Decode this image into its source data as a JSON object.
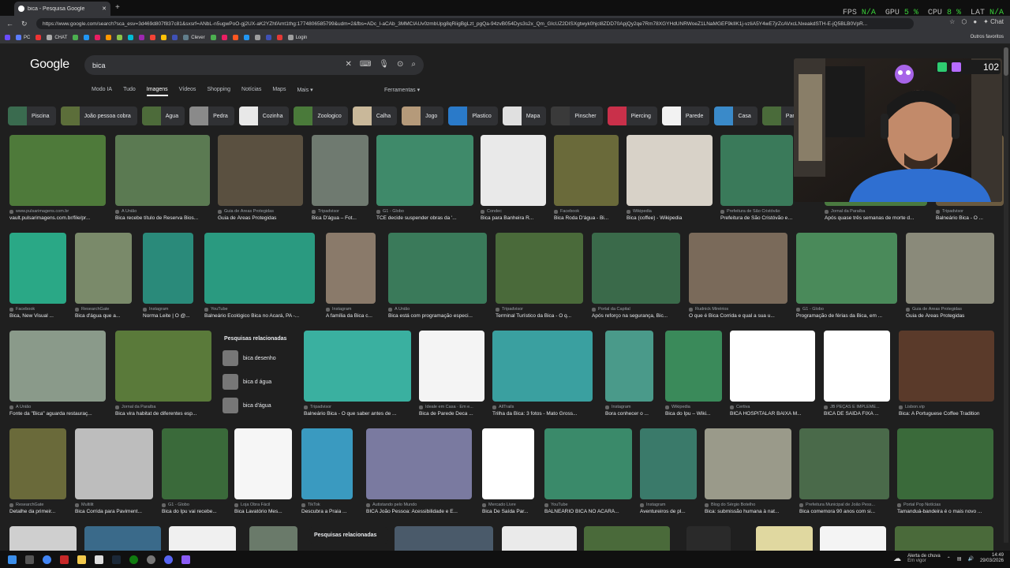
{
  "browser": {
    "tab_title": "bica - Pesquisa Google",
    "new_tab": "+",
    "url": "https://www.google.com/search?sca_esv=3d469d807f837c81&sxsrf=ANbL-n5ugwPoO-gj2UX-aK2YZhfAmt1thg:1774806585799&udm=2&fbs=ADc_l-aCAb_3MMCIAUv0zmbUpg8qRiigBgLzt_pgQa-94zvB054Dys3s2x_Qm_GIcUZ2DISXgtwyk0hjcl8ZDD70ApjQy2qe7Rm78XGYHdUNRWoeZ1LNaMGEF9kIlK1j-vzIiA5Y4wE7jrZcAVxcLNxeakdSTH-E-jQ5BLB0VpR...",
    "perf": {
      "fps_label": "FPS",
      "fps": "N/A",
      "gpu_label": "GPU",
      "gpu": "5 %",
      "cpu_label": "CPU",
      "cpu": "8 %",
      "lat_label": "LAT",
      "lat": "N/A"
    },
    "chat_label": "Chat",
    "bookmarks": [
      {
        "label": "",
        "color": "#6a4cff"
      },
      {
        "label": "PC",
        "color": "#5b7cff"
      },
      {
        "label": "",
        "color": "#e33"
      },
      {
        "label": "CHAT",
        "color": "#aaa"
      },
      {
        "label": "",
        "color": "#4caf50"
      },
      {
        "label": "",
        "color": "#2196f3"
      },
      {
        "label": "",
        "color": "#e91e63"
      },
      {
        "label": "",
        "color": "#ff9800"
      },
      {
        "label": "",
        "color": "#8bc34a"
      },
      {
        "label": "",
        "color": "#00bcd4"
      },
      {
        "label": "",
        "color": "#9c27b0"
      },
      {
        "label": "",
        "color": "#f44336"
      },
      {
        "label": "",
        "color": "#ffc107"
      },
      {
        "label": "",
        "color": "#3f51b5"
      },
      {
        "label": "Clever",
        "color": "#607d8b"
      },
      {
        "label": "",
        "color": "#4caf50"
      },
      {
        "label": "",
        "color": "#e91e63"
      },
      {
        "label": "",
        "color": "#ff5722"
      },
      {
        "label": "",
        "color": "#2196f3"
      },
      {
        "label": "",
        "color": "#9e9e9e"
      },
      {
        "label": "",
        "color": "#3f51b5"
      },
      {
        "label": "",
        "color": "#e53935"
      },
      {
        "label": "Login",
        "color": "#9e9e9e"
      }
    ],
    "other_bookmarks": "Outros favoritos"
  },
  "google": {
    "logo": "Google",
    "query": "bica",
    "modes": [
      "Modo IA",
      "Tudo",
      "Imagens",
      "Vídeos",
      "Shopping",
      "Notícias",
      "Maps",
      "Mais ▾"
    ],
    "active_mode": "Imagens",
    "tools": "Ferramentas ▾",
    "chips": [
      {
        "label": "Piscina",
        "color": "#3a6b4f"
      },
      {
        "label": "João pessoa cobra",
        "color": "#5c6e3a"
      },
      {
        "label": "Agua",
        "color": "#4d6b3a"
      },
      {
        "label": "Pedra",
        "color": "#8a8a8a"
      },
      {
        "label": "Cozinha",
        "color": "#e8e8e8"
      },
      {
        "label": "Zoologico",
        "color": "#4a7a3a"
      },
      {
        "label": "Calha",
        "color": "#c9b89a"
      },
      {
        "label": "Jogo",
        "color": "#b59a7a"
      },
      {
        "label": "Plastico",
        "color": "#2a7ac9"
      },
      {
        "label": "Mapa",
        "color": "#e0e0e0"
      },
      {
        "label": "Pinscher",
        "color": "#3a3a3a"
      },
      {
        "label": "Piercing",
        "color": "#c9304a"
      },
      {
        "label": "Parede",
        "color": "#f2f2f2"
      },
      {
        "label": "Casa",
        "color": "#3a8ac9"
      },
      {
        "label": "Parque",
        "color": "#4a6b3a"
      }
    ],
    "results": [
      {
        "src": "www.pulsarimagens.com.br",
        "cap": "vault.pulsarimagens.com.br/file/pr..."
      },
      {
        "src": "A União",
        "cap": "Bica recebe título de Reserva Bios..."
      },
      {
        "src": "Guia de Áreas Protegidas",
        "cap": "Guia de Áreas Protegidas"
      },
      {
        "src": "Tripadvisor",
        "cap": "Bica D'água – Fot..."
      },
      {
        "src": "G1 - Globo",
        "cap": "TCE decide suspender obras da '..."
      },
      {
        "src": "Condec",
        "cap": "Bica para Banheira R..."
      },
      {
        "src": "Facebook",
        "cap": "Bica Roda D'água - Bi..."
      },
      {
        "src": "Wikipedia",
        "cap": "Bica (coffee) - Wikipedia"
      },
      {
        "src": "Prefeitura de São Cristóvão",
        "cap": "Prefeitura de São Cristóvão entreg..."
      },
      {
        "src": "Jornal da Paraíba",
        "cap": "Após quase três semanas de morte d..."
      },
      {
        "src": "Tripadvisor",
        "cap": "Balneário Bica - O ..."
      },
      {
        "src": "Facebook",
        "cap": "Bica, New Visual ..."
      },
      {
        "src": "ResearchGate",
        "cap": "Bica d'água que a..."
      },
      {
        "src": "Instagram",
        "cap": "Norma Leite | O @..."
      },
      {
        "src": "YouTube",
        "cap": "Balneário Ecológico Bica no Acará, PA -..."
      },
      {
        "src": "Instagram",
        "cap": "A família da Bica c..."
      },
      {
        "src": "A União",
        "cap": "Bica está com programação especi..."
      },
      {
        "src": "Tripadvisor",
        "cap": "Terminal Turístico da Bica - O q..."
      },
      {
        "src": "Portal da Capital",
        "cap": "Após reforço na segurança, Bic..."
      },
      {
        "src": "Rudnick Minérios",
        "cap": "O que é Bica Corrida e qual a sua u..."
      },
      {
        "src": "G1 - Globo",
        "cap": "Programação de férias da Bica, em ..."
      },
      {
        "src": "Guia de Áreas Protegidas",
        "cap": "Guia de Áreas Protegidas"
      },
      {
        "src": "A União",
        "cap": "Fonte da \"Bica\" aguarda restauraç..."
      },
      {
        "src": "Jornal da Paraíba",
        "cap": "Bica vira habitat de diferentes esp..."
      },
      {
        "src": "Tripadvisor",
        "cap": "Balneário Bica - O que saber antes de ..."
      },
      {
        "src": "Ideale em Casa · Em e...",
        "cap": "Bica de Parede Deca ..."
      },
      {
        "src": "AllTrails",
        "cap": "Trilha da Bica: 3 fotos - Mato Gross..."
      },
      {
        "src": "Instagram",
        "cap": "Bora conhecer o ..."
      },
      {
        "src": "Wikipedia",
        "cap": "Bica do Ipu – Wiki..."
      },
      {
        "src": "Certiva",
        "cap": "BICA HOSPITALAR BAIXA M..."
      },
      {
        "src": "JB PEÇAS E IMPLEME...",
        "cap": "BICA DE SAÍDA FIXA ..."
      },
      {
        "src": "Lisbon.vip",
        "cap": "Bica: A Portuguese Coffee Tradition"
      },
      {
        "src": "ResearchGate",
        "cap": "Detalhe da primeir..."
      },
      {
        "src": "Multilit",
        "cap": "Bica Corrida para Paviment..."
      },
      {
        "src": "G1 - Globo",
        "cap": "Bica do Ipu vai recebe..."
      },
      {
        "src": "Loja Obra Fácil",
        "cap": "Bica Lavatório Mes..."
      },
      {
        "src": "TikTok",
        "cap": "Descubra a Praia ..."
      },
      {
        "src": "Autistando pelo Mundo",
        "cap": "BICA João Pessoa: Acessibilidade e E..."
      },
      {
        "src": "Mercado Livre",
        "cap": "Bica De Saída Par..."
      },
      {
        "src": "YouTube",
        "cap": "BALNEÁRIO BICA NO ACARÁ..."
      },
      {
        "src": "Instagram",
        "cap": "Aventureiros de pl..."
      },
      {
        "src": "Blog do Sérgio Botelho",
        "cap": "Bica: submissão humana à nat..."
      },
      {
        "src": "Prefeitura Municipal de João Pess...",
        "cap": "Bica comemora 90 anos com si..."
      },
      {
        "src": "Portal Pop Notícias",
        "cap": "Tamanduá-bandeira é o mais novo ..."
      }
    ],
    "related_title": "Pesquisas relacionadas",
    "related": [
      "bica desenho",
      "bica d água",
      "bica d'água"
    ],
    "related2_title": "Pesquisas relacionadas"
  },
  "overlay": {
    "count": "102",
    "image_text_1": "BICA",
    "image_text_2": "Balneário BICA",
    "image_text_3": "BICA"
  },
  "taskbar": {
    "weather_title": "Alerta de chuva",
    "weather_sub": "Em vigor",
    "time": "14:49",
    "date": "29/03/2026"
  }
}
